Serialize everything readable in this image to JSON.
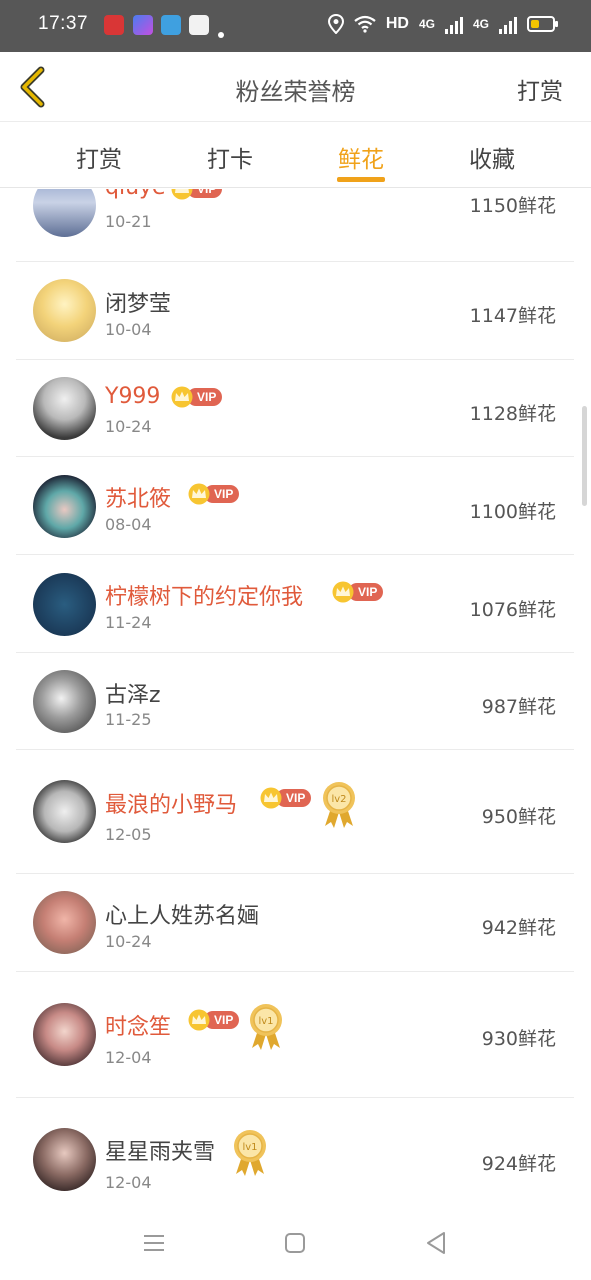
{
  "status_bar": {
    "time": "17:37",
    "hd_label": "HD",
    "net_label_1": "4G",
    "net_label_2": "4G"
  },
  "header": {
    "title": "粉丝荣誉榜",
    "action_label": "打赏",
    "back_icon": "chevron-left-icon",
    "accent_color": "#d6a600"
  },
  "tabs": [
    {
      "label": "打赏",
      "active": false
    },
    {
      "label": "打卡",
      "active": false
    },
    {
      "label": "鲜花",
      "active": true
    },
    {
      "label": "收藏",
      "active": false
    }
  ],
  "active_color": "#f0a21a",
  "vip_label": "VIP",
  "fans": [
    {
      "name": "qiuye",
      "date": "10-21",
      "amount": "1150鲜花",
      "vip": true,
      "medal": ""
    },
    {
      "name": "闭梦莹",
      "date": "10-04",
      "amount": "1147鲜花",
      "vip": false,
      "medal": ""
    },
    {
      "name": "Y999",
      "date": "10-24",
      "amount": "1128鲜花",
      "vip": true,
      "medal": ""
    },
    {
      "name": "苏北筱",
      "date": "08-04",
      "amount": "1100鲜花",
      "vip": true,
      "medal": ""
    },
    {
      "name": "柠檬树下的约定你我",
      "date": "11-24",
      "amount": "1076鲜花",
      "vip": true,
      "medal": ""
    },
    {
      "name": "古泽z",
      "date": "11-25",
      "amount": "987鲜花",
      "vip": false,
      "medal": ""
    },
    {
      "name": "最浪的小野马",
      "date": "12-05",
      "amount": "950鲜花",
      "vip": true,
      "medal": "lv2"
    },
    {
      "name": "心上人姓苏名婳",
      "date": "10-24",
      "amount": "942鲜花",
      "vip": false,
      "medal": ""
    },
    {
      "name": "时念笙",
      "date": "12-04",
      "amount": "930鲜花",
      "vip": true,
      "medal": "lv1"
    },
    {
      "name": "星星雨夹雪",
      "date": "12-04",
      "amount": "924鲜花",
      "vip": false,
      "medal": "lv1"
    }
  ],
  "navbar": {
    "menu_icon": "menu-icon",
    "home_icon": "square-home-icon",
    "back_icon": "triangle-back-icon"
  }
}
